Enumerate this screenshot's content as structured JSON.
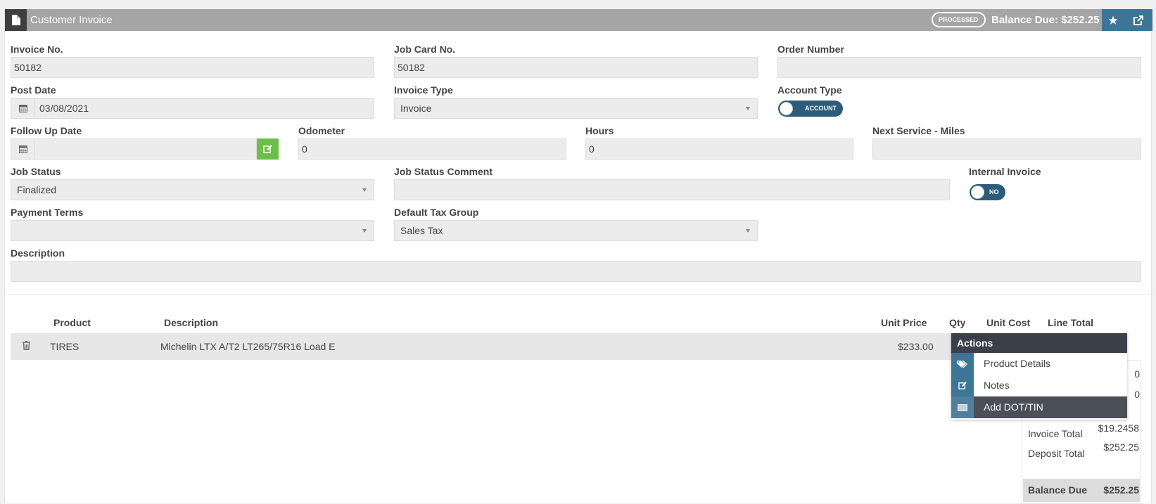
{
  "header": {
    "title": "Customer Invoice",
    "status_badge": "PROCESSED",
    "balance_due": "Balance Due: $252.25",
    "icons": [
      "document-icon",
      "star-icon",
      "external-link-icon"
    ]
  },
  "form": {
    "invoice_no": {
      "label": "Invoice No.",
      "value": "50182"
    },
    "job_card_no": {
      "label": "Job Card No.",
      "value": "50182"
    },
    "order_number": {
      "label": "Order Number",
      "value": ""
    },
    "post_date": {
      "label": "Post Date",
      "value": "03/08/2021"
    },
    "invoice_type": {
      "label": "Invoice Type",
      "value": "Invoice"
    },
    "account_type": {
      "label": "Account Type",
      "toggle_text": "ACCOUNT"
    },
    "follow_up_date": {
      "label": "Follow Up Date",
      "value": ""
    },
    "odometer": {
      "label": "Odometer",
      "value": "0"
    },
    "hours": {
      "label": "Hours",
      "value": "0"
    },
    "next_service_miles": {
      "label": "Next Service - Miles",
      "value": ""
    },
    "job_status": {
      "label": "Job Status",
      "value": "Finalized"
    },
    "job_status_comment": {
      "label": "Job Status Comment",
      "value": ""
    },
    "internal_invoice": {
      "label": "Internal Invoice",
      "toggle_text": "NO"
    },
    "payment_terms": {
      "label": "Payment Terms",
      "value": ""
    },
    "default_tax_group": {
      "label": "Default Tax Group",
      "value": "Sales Tax"
    },
    "description": {
      "label": "Description",
      "value": ""
    }
  },
  "table": {
    "headers": [
      "Product",
      "Description",
      "Unit Price",
      "Qty",
      "Unit Cost",
      "Line Total"
    ],
    "rows": [
      {
        "product": "TIRES",
        "description": "Michelin LTX A/T2 LT265/75R16 Load E",
        "unit_price": "$233.00"
      }
    ]
  },
  "actions_menu": {
    "title": "Actions",
    "items": [
      {
        "label": "Product Details",
        "icon": "tags-icon"
      },
      {
        "label": "Notes",
        "icon": "edit-icon"
      },
      {
        "label": "Add DOT/TIN",
        "icon": "barcode-icon"
      }
    ]
  },
  "totals": {
    "partial_1": "0",
    "partial_2": "0",
    "tax_value": "$19.2458",
    "invoice_total_label": "Invoice Total",
    "deposit_total_label": "Deposit Total",
    "deposit_total_value": "$252.25",
    "balance_due_label": "Balance Due",
    "balance_due_value": "$252.25"
  },
  "colors": {
    "header_bg": "#a5a5a5",
    "accent_blue": "#3c7596",
    "menu_title_bg": "#3a3f4a",
    "green_button": "#6cc04a"
  }
}
